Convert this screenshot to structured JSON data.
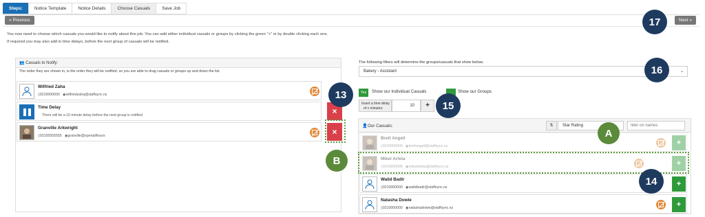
{
  "tabs": [
    "Steps:",
    "Notice Template",
    "Notice Details",
    "Choose Casuals",
    "Save Job"
  ],
  "buttons": {
    "previous": "Previous",
    "next": "Next"
  },
  "intro": [
    "You now need to choose which casuals you would like to notify about this job. You can add either individual casuals or groups by clicking the green \"+\" or by double clicking each one.",
    "If required you may also add in time delays, before the next group of casuals will be notified."
  ],
  "notify": {
    "title": "Casuals to Notify:",
    "hint": "The order they are shown in, is the order they will be notified, so you are able to drag casuals or groups up and down the list.",
    "rows": [
      {
        "name": "Wilfried Zaha",
        "phone": "0210000000",
        "email": "wilfriedzaha@staffsync.nz"
      },
      {
        "name": "Time Delay",
        "note": "There will be a 10 minute delay before the next group is notified"
      },
      {
        "name": "Granville Arkwright",
        "phone": "02155555555",
        "email": "granville@openallhours"
      }
    ],
    "remove_symbol": "×"
  },
  "filters": {
    "heading": "The following filters will determine the groups/casuals that show below.",
    "select_value": "Bakery - Assistant",
    "toggle_yes": "Yes",
    "show_individual": "Show our Individual Casuals",
    "show_groups": "Show our Groups",
    "delay_label_1": "Insert a time delay",
    "delay_label_2": "of x minutes:",
    "delay_value": "10",
    "add_symbol": "+"
  },
  "casuals": {
    "title": "Our Casuals:",
    "sort_value": "Star Rating",
    "filter_placeholder": "filter on names",
    "rows": [
      {
        "name": "Brett Angell",
        "phone": "0210000000",
        "email": "brettangell@staffsync.nz"
      },
      {
        "name": "Mikel Arteta",
        "phone": "0210000000",
        "email": "mikelarteta@staffsync.nz"
      },
      {
        "name": "Walid Badir",
        "phone": "0210000000",
        "email": "walidbadir@staffsync.nz"
      },
      {
        "name": "Natasha Dowie",
        "phone": "0210000000",
        "email": "natashadowie@staffsync.nz"
      }
    ]
  },
  "callouts": {
    "c17": "17",
    "c16": "16",
    "c13": "13",
    "c15": "15",
    "c14": "14",
    "cA": "A",
    "cB": "B"
  },
  "colors": {
    "steps_tab": "#1a6fb5",
    "remove": "#d9404a",
    "add": "#2f9a3b",
    "callout_navy": "#1e3a5f",
    "callout_olive": "#5a8a3a",
    "no_notify": "#e08a3b"
  }
}
